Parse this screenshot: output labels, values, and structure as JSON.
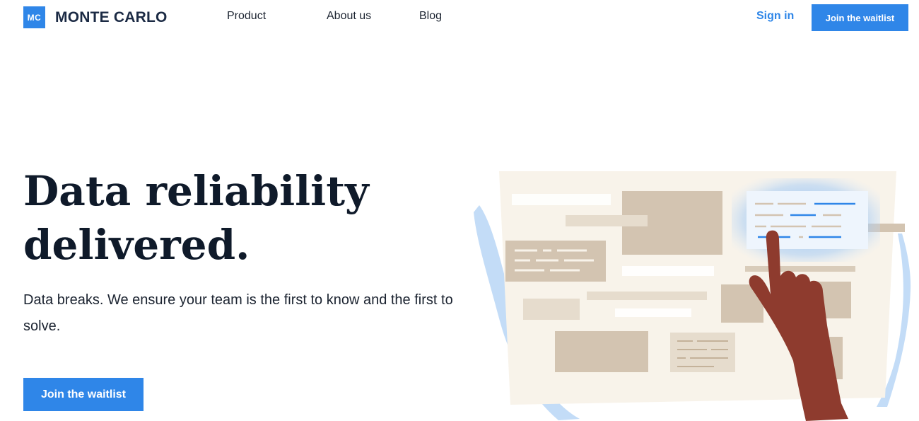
{
  "brand": {
    "mark": "MC",
    "name": "MONTE CARLO"
  },
  "nav": {
    "product": "Product",
    "about": "About us",
    "blog": "Blog"
  },
  "header_actions": {
    "signin": "Sign in",
    "cta": "Join the waitlist"
  },
  "hero": {
    "headline_line1": "Data reliability",
    "headline_line2": "delivered.",
    "subtext": "Data breaks. We ensure your team is the first to know and the first to solve.",
    "cta": "Join the waitlist"
  },
  "colors": {
    "accent": "#2f86e8",
    "ink": "#0f1a2a",
    "panel": "#f8f3ea",
    "tan": "#d3c4b1",
    "hand": "#8e3b2e",
    "glow": "#7eb6f3"
  },
  "illustration": {
    "icon": "dashboard-hand-illustration"
  }
}
